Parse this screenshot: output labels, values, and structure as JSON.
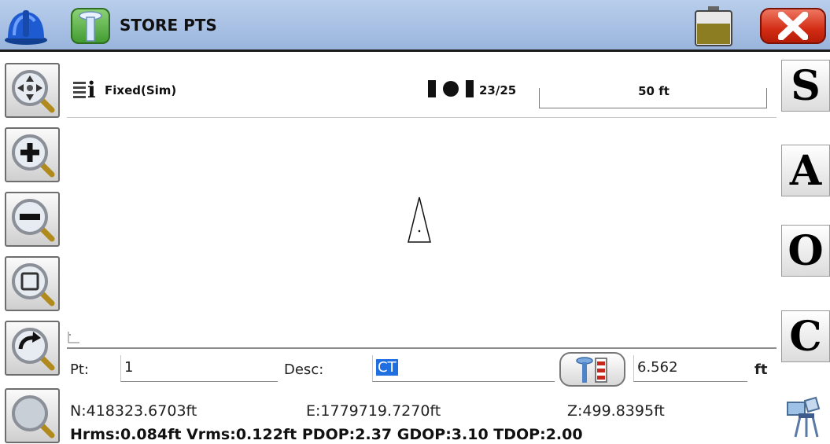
{
  "titlebar": {
    "title": "STORE PTS",
    "icons": [
      "hardhat-icon",
      "gps-rod-icon",
      "battery-icon",
      "close-icon"
    ]
  },
  "left_toolbar": {
    "tools": [
      "zoom-pan-icon",
      "zoom-in-icon",
      "zoom-out-icon",
      "zoom-window-icon",
      "zoom-previous-icon",
      "zoom-extents-icon"
    ]
  },
  "right_toolbar": {
    "buttons": [
      "S",
      "A",
      "O",
      "C"
    ],
    "extra_icon": "survey-settings-icon"
  },
  "map": {
    "fix_status": "Fixed(Sim)",
    "satellites": "23/25",
    "scale": "50 ft"
  },
  "panel": {
    "pt_label": "Pt:",
    "pt_value": "1",
    "desc_label": "Desc:",
    "desc_value": "CT",
    "rod_height": "6.562",
    "rod_unit": "ft",
    "north": "N:418323.6703ft",
    "east": "E:1779719.7270ft",
    "elev": "Z:499.8395ft",
    "quality": "Hrms:0.084ft Vrms:0.122ft PDOP:2.37 GDOP:3.10 TDOP:2.00"
  },
  "colors": {
    "titlebar": "#a8c0e4",
    "close": "#d22c14",
    "app_icon": "#3f9a2e",
    "selection": "#1f6fe0"
  }
}
